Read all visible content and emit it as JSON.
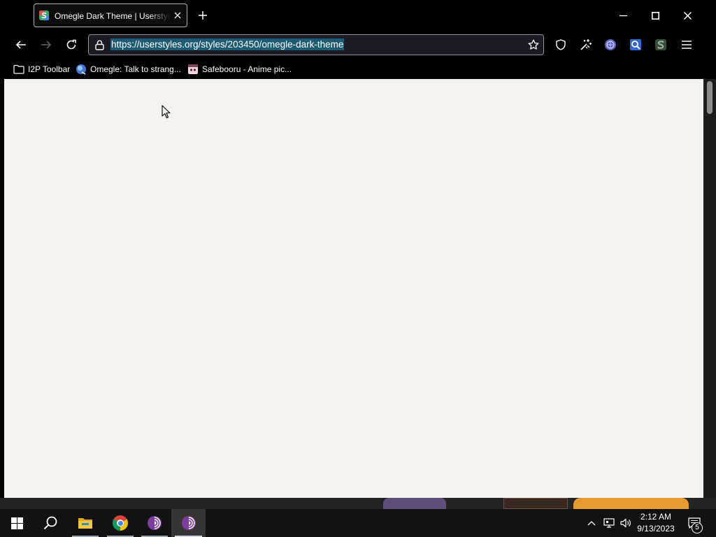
{
  "tabs": [
    {
      "title": "Omegle Dark Theme | Userstyle",
      "favicon": "userstyles-favicon",
      "active": true,
      "close_icon": "close-icon"
    }
  ],
  "new_tab_icon": "plus-icon",
  "window_controls": {
    "minimize_icon": "minimize-icon",
    "maximize_icon": "maximize-icon",
    "close_icon": "close-icon"
  },
  "navigation": {
    "back_icon": "arrow-left-icon",
    "forward_icon": "arrow-right-icon",
    "forward_enabled": false,
    "reload_icon": "reload-icon"
  },
  "address_bar": {
    "url": "https://userstyles.org/styles/203450/omegle-dark-theme",
    "url_selected": true,
    "lock_icon": "lock-icon",
    "bookmark_icon": "star-icon"
  },
  "toolbar_icons": [
    "shield-icon",
    "sparkle-icon",
    "extension-purple-icon",
    "extension-blue-icon",
    "extension-s-icon",
    "hamburger-menu-icon"
  ],
  "bookmarks": [
    {
      "label": "I2P Toolbar",
      "icon": "folder-icon"
    },
    {
      "label": "Omegle: Talk to strang...",
      "icon": "omegle-favicon"
    },
    {
      "label": "Safebooru - Anime pic...",
      "icon": "safebooru-favicon"
    }
  ],
  "page": {
    "scroll_fraction": 0
  },
  "taskbar": {
    "apps": [
      "windows-start-icon",
      "search-icon",
      "file-explorer-icon",
      "chrome-icon",
      "tor-browser-icon",
      "tor-browser-icon"
    ],
    "active_app_index": 5,
    "tray_icons": [
      "chevron-up-icon",
      "network-icon",
      "volume-icon",
      "notification-icon"
    ],
    "clock_time": "2:12 AM",
    "clock_date": "9/13/2023",
    "notification_count": "5"
  },
  "colors": {
    "chrome_bg": "#000000",
    "urlbar_bg": "#1c1b22",
    "selection": "#1c5c73",
    "content_bg": "#f4f3ef",
    "taskbar_bg": "#121212"
  }
}
